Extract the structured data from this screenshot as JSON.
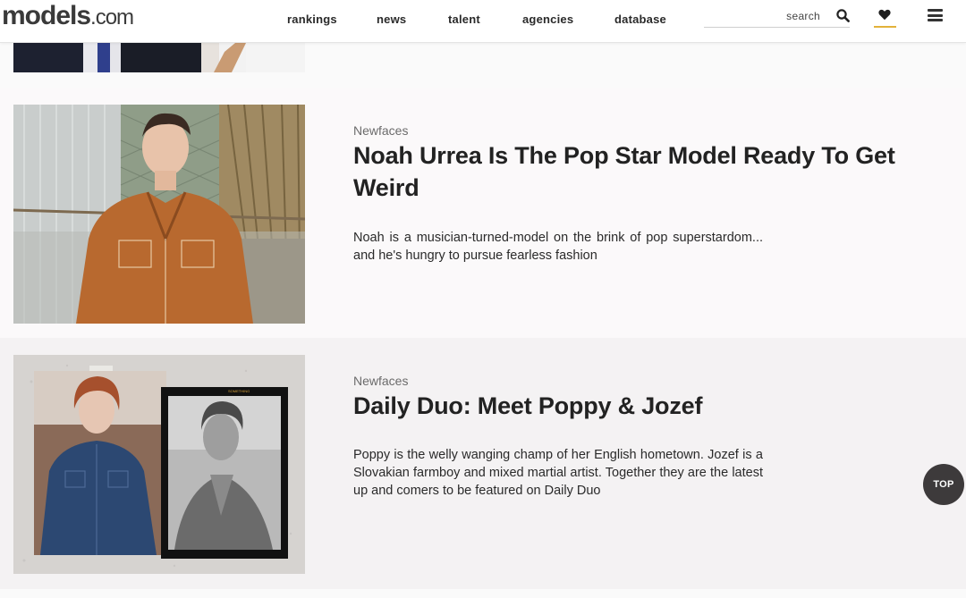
{
  "header": {
    "logo": {
      "word": "models",
      "tld": ".com"
    },
    "nav": [
      {
        "label": "rankings"
      },
      {
        "label": "news"
      },
      {
        "label": "talent"
      },
      {
        "label": "agencies"
      },
      {
        "label": "database"
      }
    ],
    "search": {
      "placeholder": "search",
      "icon": "search-icon"
    },
    "favorites": {
      "icon": "heart-icon",
      "accent": "#e2b23a"
    },
    "menu": {
      "icon": "hamburger-menu-icon"
    }
  },
  "articles": [
    {
      "category": "Newfaces",
      "headline": "Noah Urrea Is The Pop Star Model Ready To Get Weird",
      "summary": "Noah is a musician-turned-model on the brink of pop superstardom... and he's hungry to pursue fearless fashion"
    },
    {
      "category": "Newfaces",
      "headline": "Daily Duo: Meet Poppy & Jozef",
      "summary": "Poppy is the welly wanging champ of her English hometown. Jozef is a Slovakian farmboy and mixed martial artist. Together they are the latest up and comers to be featured on Daily Duo"
    }
  ],
  "top_button": {
    "label": "TOP"
  },
  "colors": {
    "accent": "#e2b23a",
    "top_button_bg": "#3d3a3b"
  }
}
